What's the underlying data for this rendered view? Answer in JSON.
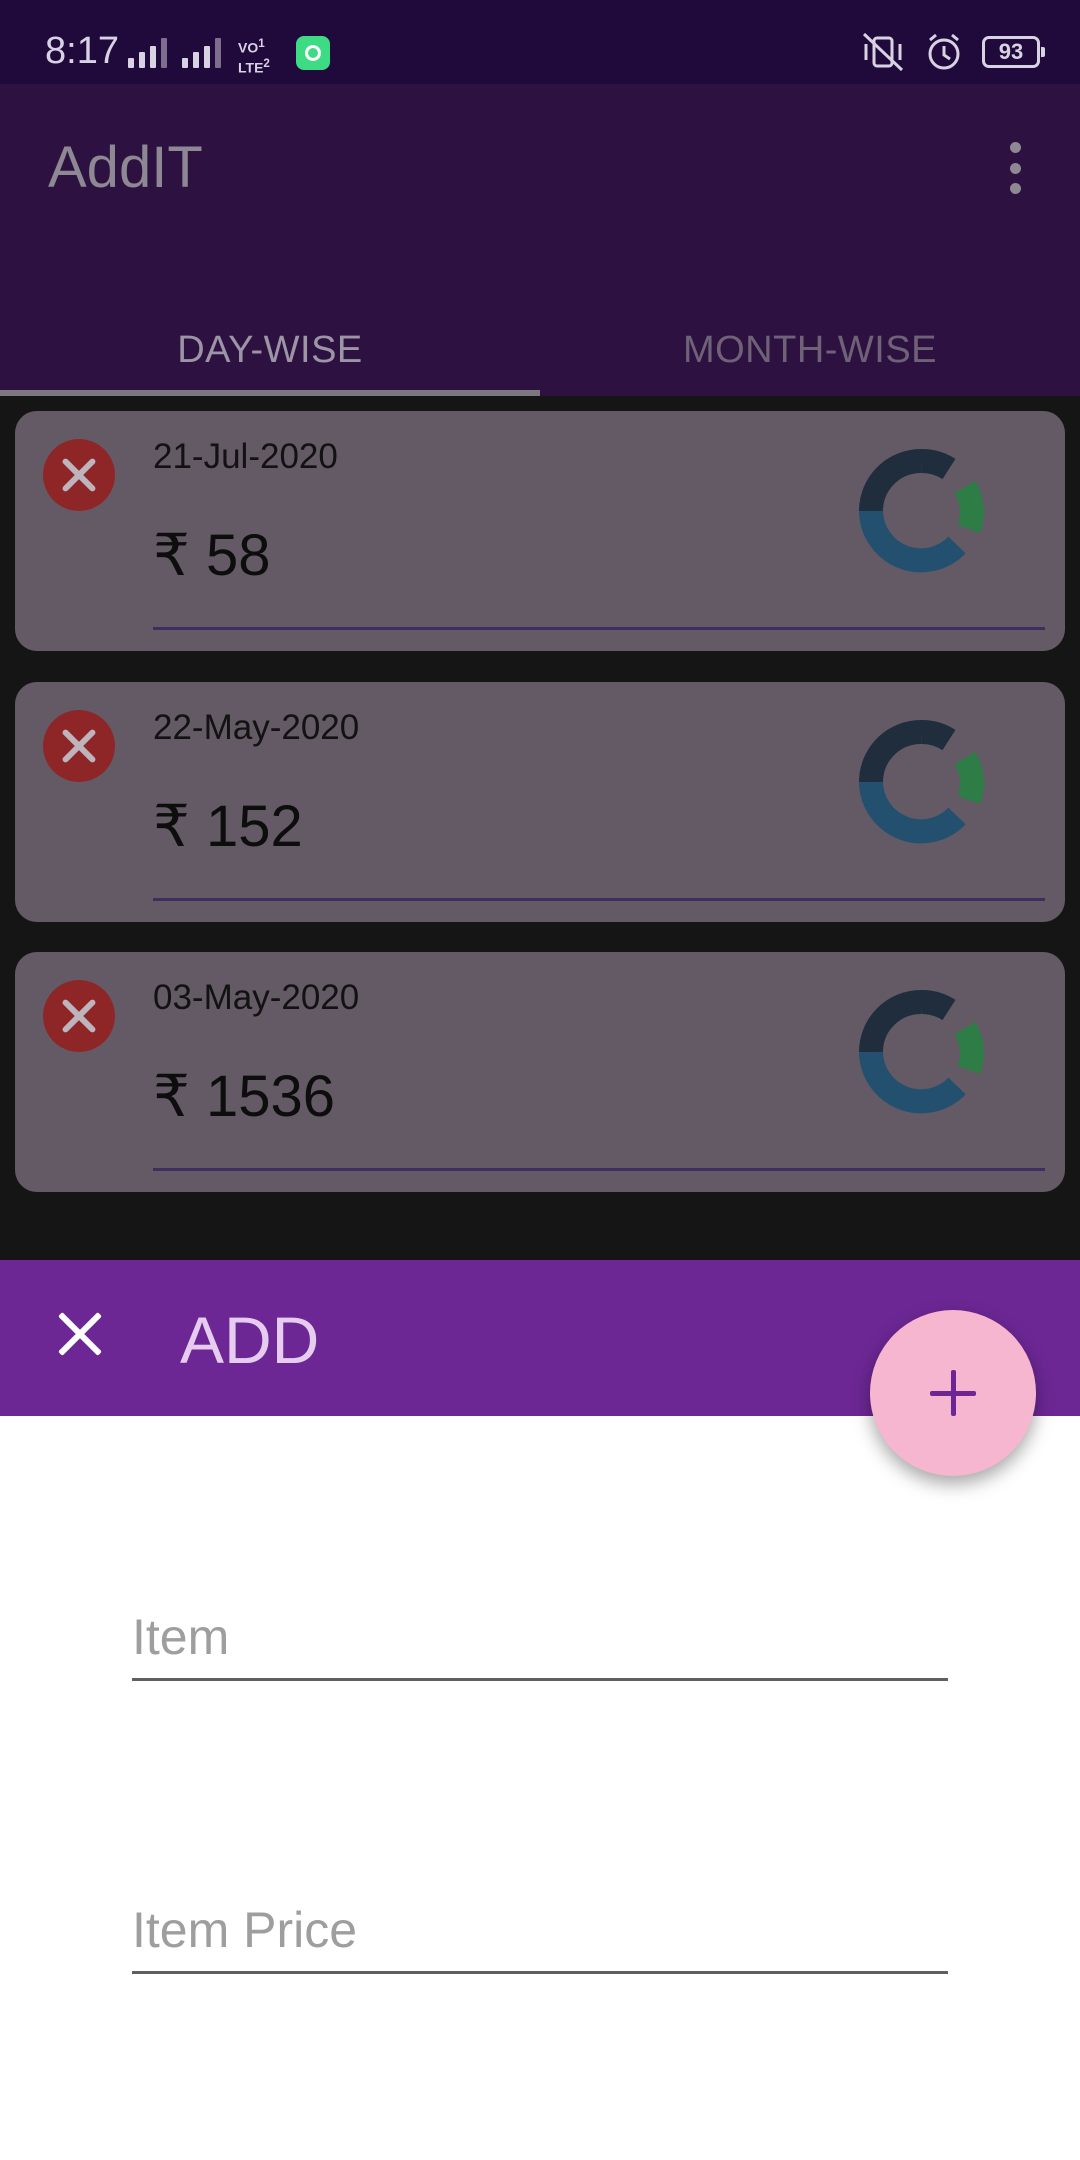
{
  "status_bar": {
    "time": "8:17",
    "carrier_badge": "VO 1\nLTE 2",
    "battery": "93",
    "icons": [
      "signal-1-icon",
      "signal-2-icon",
      "volte-lte-icon",
      "app-notification-icon",
      "vibrate-icon",
      "alarm-icon",
      "battery-icon"
    ]
  },
  "app_bar": {
    "title": "AddIT",
    "menu_icon": "overflow-menu-icon",
    "tabs": [
      {
        "label": "DAY-WISE",
        "active": true
      },
      {
        "label": "MONTH-WISE",
        "active": false
      }
    ]
  },
  "entries": [
    {
      "date": "21-Jul-2020",
      "amount": "₹ 58"
    },
    {
      "date": "22-May-2020",
      "amount": "₹ 152"
    },
    {
      "date": "03-May-2020",
      "amount": "₹ 1536"
    }
  ],
  "add_sheet": {
    "title": "ADD",
    "close_icon": "close-icon",
    "fab_icon": "plus-icon",
    "item_placeholder": "Item",
    "price_placeholder": "Item Price"
  },
  "colors": {
    "status_bar": "#200a3c",
    "app_bar": "#2d1141",
    "card": "#645a65",
    "delete": "#8e2627",
    "sheet_header": "#6c2794",
    "fab": "#f6b6cf",
    "chart_dark": "#1f2d3d",
    "chart_blue": "#22506e",
    "chart_green": "#2e7d46"
  }
}
